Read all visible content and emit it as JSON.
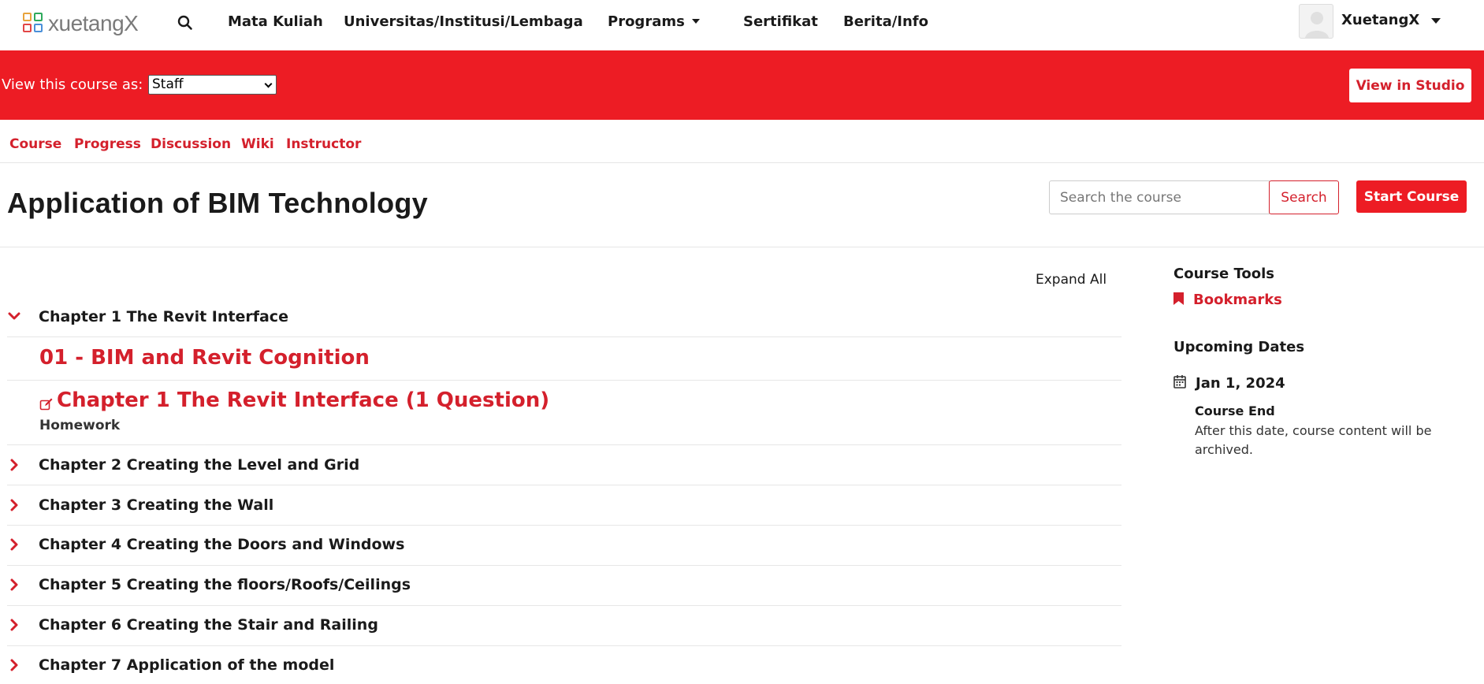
{
  "brand": {
    "logo_text": "xuetangX"
  },
  "topnav": {
    "items": [
      {
        "label": "Mata Kuliah"
      },
      {
        "label": "Universitas/Institusi/Lembaga"
      },
      {
        "label": "Programs"
      },
      {
        "label": "Sertifikat"
      },
      {
        "label": "Berita/Info"
      }
    ],
    "user_name": "XuetangX"
  },
  "staff_bar": {
    "label": "View this course as:",
    "selected_role": "Staff",
    "studio_button": "View in Studio",
    "color": "#ed1c24"
  },
  "course_tabs": [
    "Course",
    "Progress",
    "Discussion",
    "Wiki",
    "Instructor"
  ],
  "course": {
    "title": "Application of BIM Technology",
    "search_placeholder": "Search the course",
    "search_button": "Search",
    "start_button": "Start Course"
  },
  "outline": {
    "expand_all": "Expand All",
    "chapters": [
      {
        "title": "Chapter 1 The Revit Interface",
        "expanded": true,
        "subsections": [
          {
            "title": "01 - BIM and Revit Cognition",
            "meta": ""
          },
          {
            "title": "Chapter 1 The Revit Interface (1 Question)",
            "meta": "Homework",
            "icon": "edit-icon"
          }
        ]
      },
      {
        "title": "Chapter 2 Creating the Level and Grid",
        "expanded": false
      },
      {
        "title": "Chapter 3 Creating the Wall",
        "expanded": false
      },
      {
        "title": "Chapter 4 Creating the Doors and Windows",
        "expanded": false
      },
      {
        "title": "Chapter 5 Creating the floors/Roofs/Ceilings",
        "expanded": false
      },
      {
        "title": "Chapter 6 Creating the Stair and Railing",
        "expanded": false
      },
      {
        "title": "Chapter 7 Application of the model",
        "expanded": false
      }
    ]
  },
  "sidebar": {
    "tools_heading": "Course Tools",
    "bookmarks_label": "Bookmarks",
    "dates_heading": "Upcoming Dates",
    "date": "Jan 1, 2024",
    "date_title": "Course End",
    "date_description": "After this date, course content will be archived."
  },
  "colors": {
    "accent": "#d4202c",
    "staff_bar": "#ed1c24"
  }
}
